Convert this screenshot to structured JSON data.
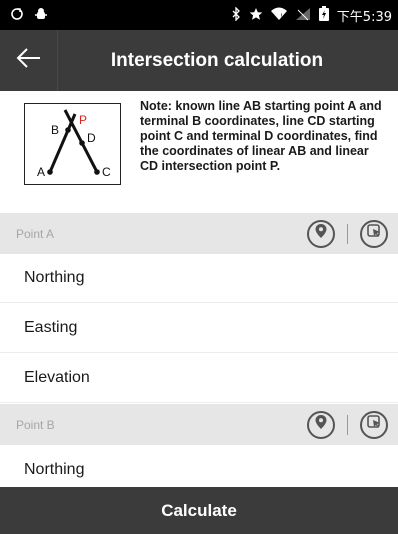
{
  "status_bar": {
    "time": "下午5:39"
  },
  "header": {
    "title": "Intersection calculation"
  },
  "note": {
    "text": "Note: known line AB starting point A and terminal B coordinates, line CD starting point C and terminal D coordinates, find the coordinates of linear AB and linear CD intersection point P.",
    "diagram_labels": {
      "a": "A",
      "b": "B",
      "c": "C",
      "d": "D",
      "p": "P"
    }
  },
  "sections": [
    {
      "label": "Point A",
      "fields": [
        {
          "label": "Northing",
          "value": ""
        },
        {
          "label": "Easting",
          "value": ""
        },
        {
          "label": "Elevation",
          "value": ""
        }
      ]
    },
    {
      "label": "Point B",
      "fields": [
        {
          "label": "Northing",
          "value": ""
        }
      ]
    }
  ],
  "footer": {
    "calculate_label": "Calculate"
  },
  "icons": {
    "back": "arrow-left-icon",
    "locate": "location-pin-icon",
    "pick": "select-point-icon"
  },
  "colors": {
    "app_bar": "#3b3b3b",
    "section_bg": "#e6e6e6",
    "point_p": "#e02020"
  }
}
